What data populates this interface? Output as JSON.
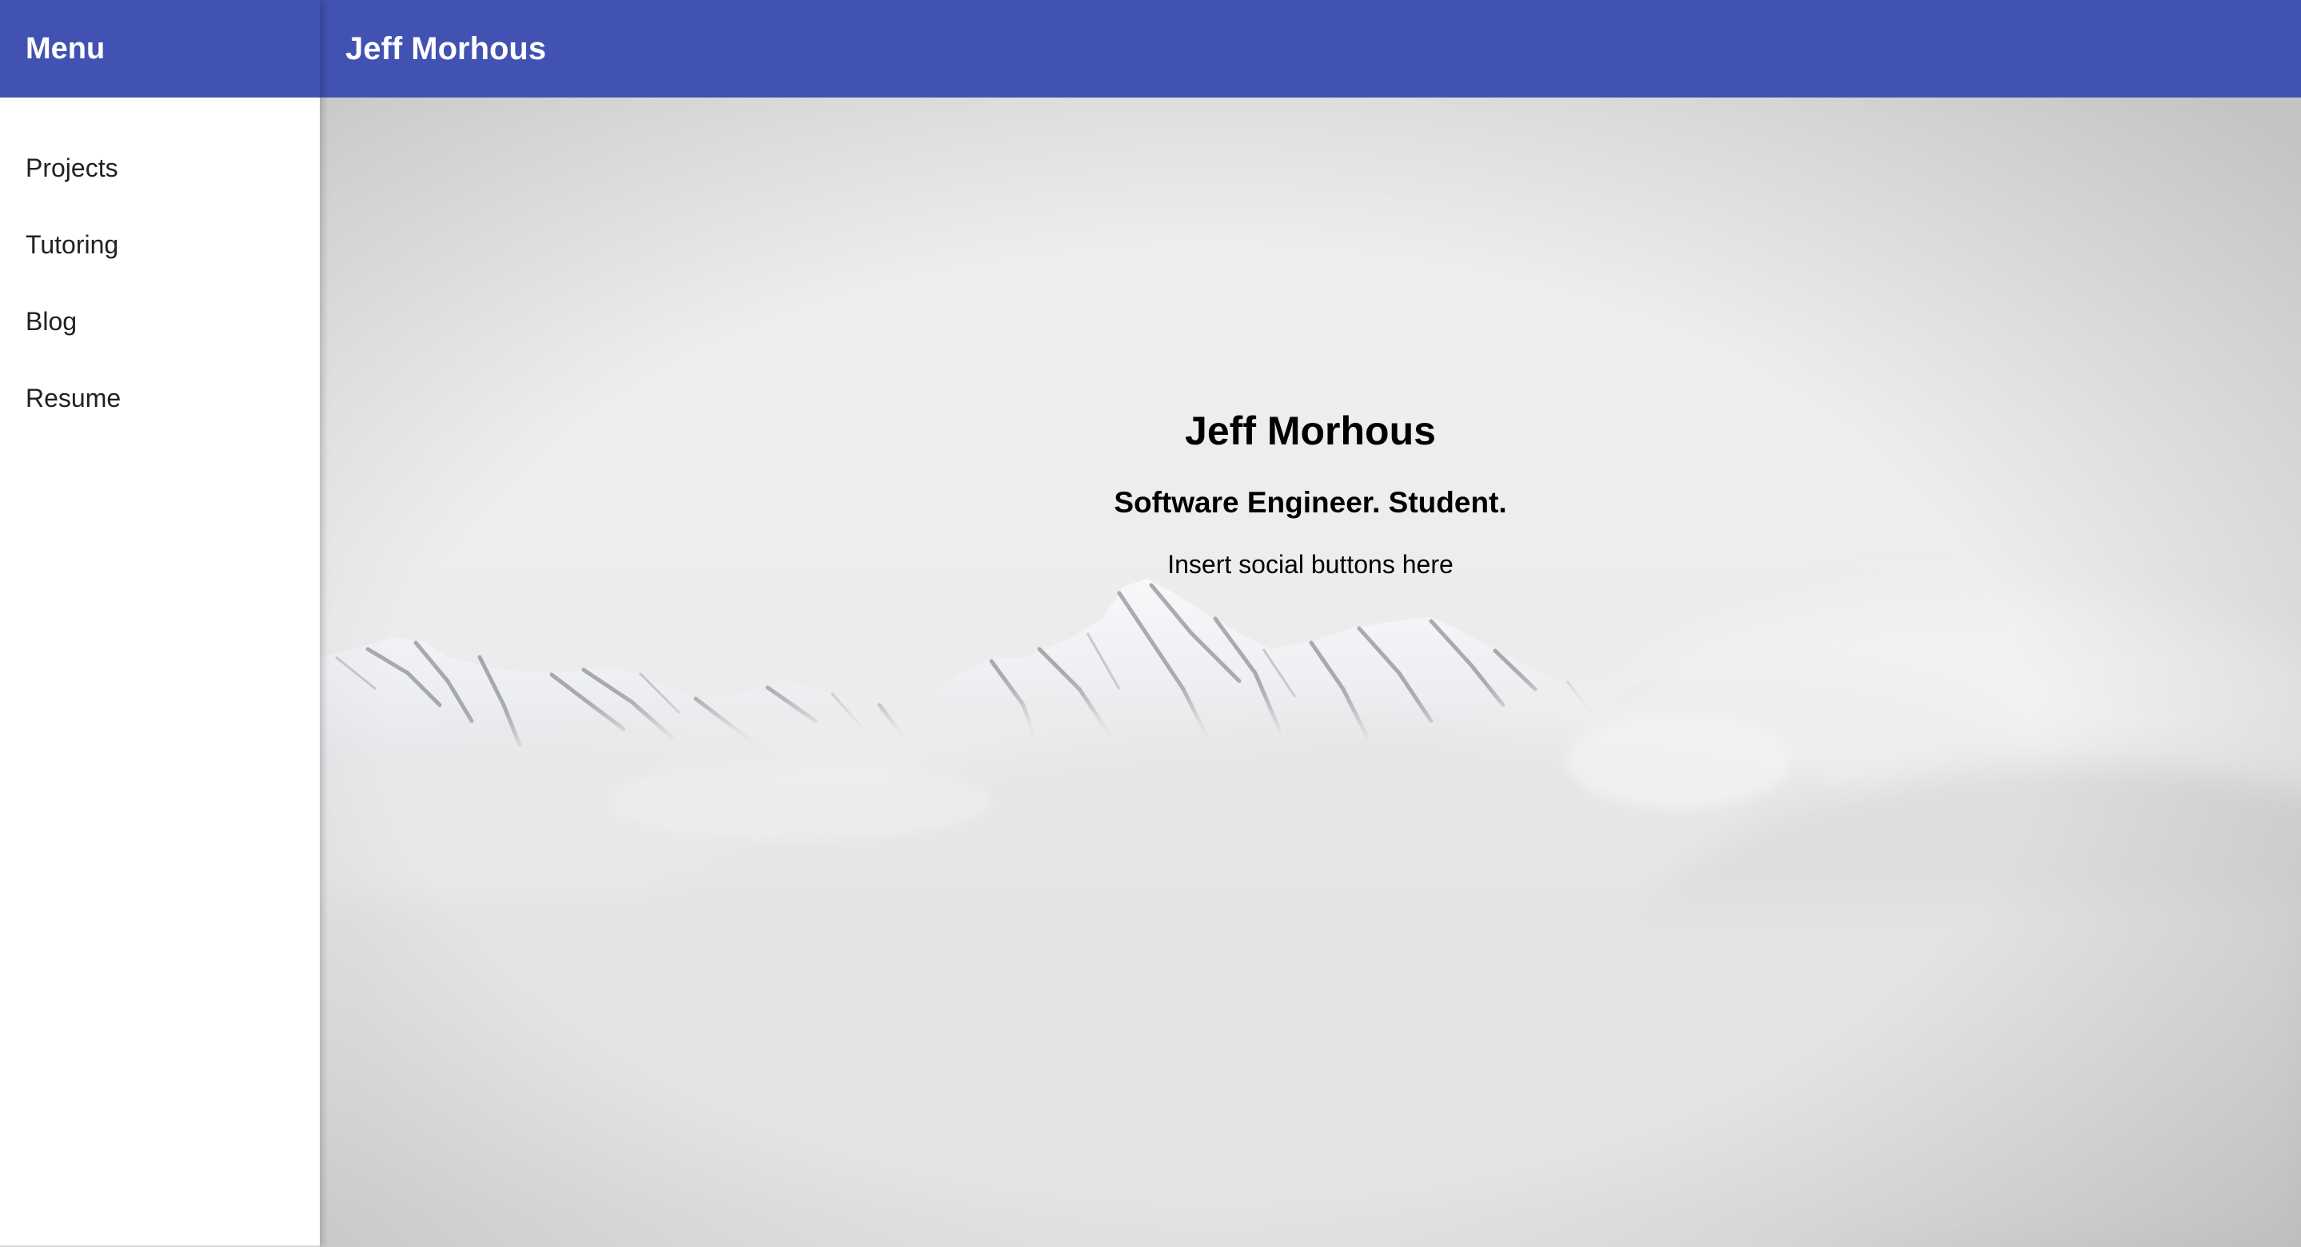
{
  "drawer": {
    "title": "Menu",
    "items": [
      {
        "label": "Projects"
      },
      {
        "label": "Tutoring"
      },
      {
        "label": "Blog"
      },
      {
        "label": "Resume"
      }
    ]
  },
  "appbar": {
    "title": "Jeff Morhous"
  },
  "hero": {
    "name": "Jeff Morhous",
    "tagline": "Software Engineer. Student.",
    "social_placeholder": "Insert social buttons here",
    "background": "snowy-mountains-above-clouds"
  },
  "colors": {
    "primary": "#4152b3",
    "drawer_bg": "#ffffff",
    "text": "#212121"
  }
}
